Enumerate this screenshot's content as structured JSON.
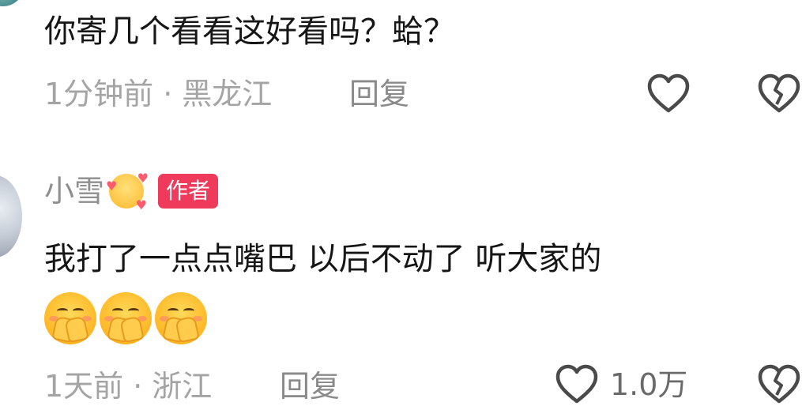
{
  "comment_top": {
    "text": "你寄几个看看这好看吗？蛤？",
    "time": "1分钟前",
    "separator": "·",
    "location": "黑龙江",
    "reply_label": "回复"
  },
  "comment_author": {
    "username": "小雪",
    "badge": "作者",
    "text": "我打了一点点嘴巴 以后不动了 听大家的",
    "time": "1天前",
    "separator": "·",
    "location": "浙江",
    "reply_label": "回复",
    "like_count": "1.0万"
  },
  "icons": {
    "like": "heart-outline-icon",
    "dislike": "broken-heart-icon",
    "emoji": "hands-over-mouth-emoji",
    "username_emoji": "smiling-face-with-hearts-emoji"
  },
  "colors": {
    "badge_bg": "#f03a5c",
    "meta_text": "#a4a4a4",
    "main_text": "#161616"
  }
}
